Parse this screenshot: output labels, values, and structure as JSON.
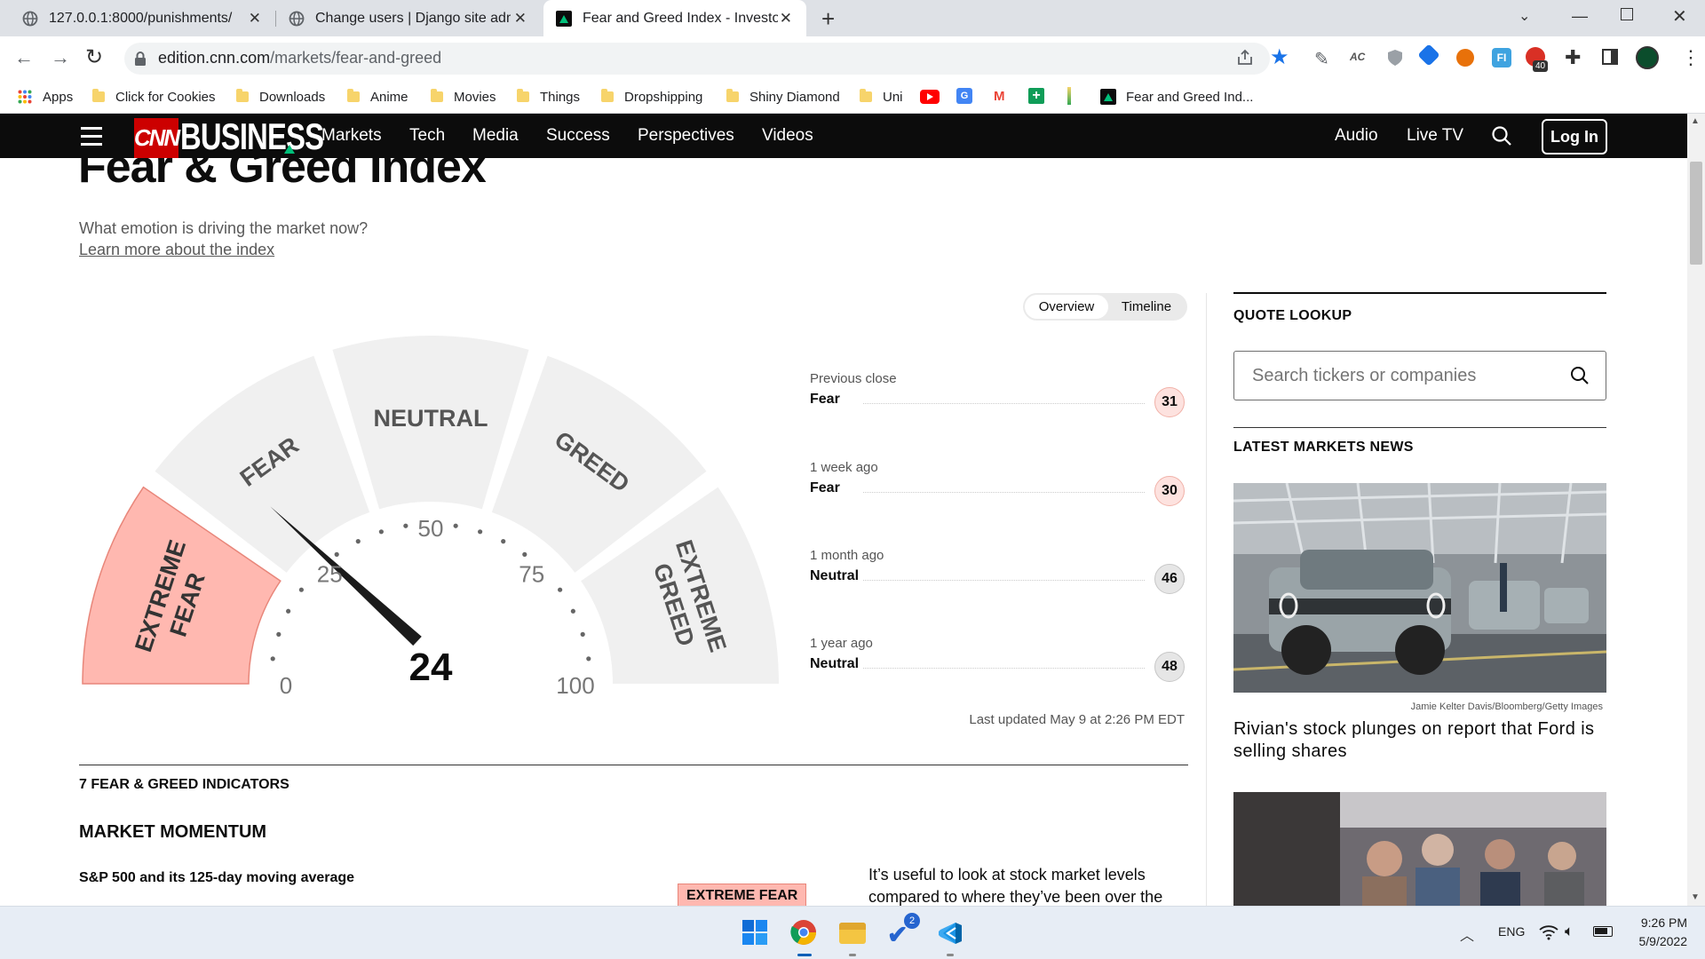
{
  "browser": {
    "tabs": [
      {
        "title": "127.0.0.1:8000/punishments/",
        "active": false
      },
      {
        "title": "Change users | Django site admin",
        "active": false
      },
      {
        "title": "Fear and Greed Index - Investor S",
        "active": true
      }
    ],
    "url_domain": "edition.cnn.com",
    "url_path": "/markets/fear-and-greed",
    "bookmarks": [
      "Apps",
      "Click for Cookies",
      "Downloads",
      "Anime",
      "Movies",
      "Things",
      "Dropshipping",
      "Shiny Diamond",
      "Uni",
      "Fear and Greed Ind..."
    ],
    "extension_badge": "40"
  },
  "nav": {
    "brand": "BUSINESS",
    "logo": "CNN",
    "links": [
      "Markets",
      "Tech",
      "Media",
      "Success",
      "Perspectives",
      "Videos"
    ],
    "right_links": [
      "Audio",
      "Live TV"
    ],
    "login": "Log In"
  },
  "page": {
    "title": "Fear & Greed Index",
    "subtitle": "What emotion is driving the market now?",
    "learn_more": "Learn more about the index"
  },
  "toggle": {
    "options": [
      "Overview",
      "Timeline"
    ],
    "selected": "Overview"
  },
  "gauge": {
    "value": 24,
    "segments": [
      "EXTREME FEAR",
      "FEAR",
      "NEUTRAL",
      "GREED",
      "EXTREME GREED"
    ],
    "ticks": [
      "0",
      "25",
      "50",
      "75",
      "100"
    ],
    "active_segment": "EXTREME FEAR"
  },
  "history": [
    {
      "label": "Previous close",
      "rating": "Fear",
      "value": "31"
    },
    {
      "label": "1 week ago",
      "rating": "Fear",
      "value": "30"
    },
    {
      "label": "1 month ago",
      "rating": "Neutral",
      "value": "46"
    },
    {
      "label": "1 year ago",
      "rating": "Neutral",
      "value": "48"
    }
  ],
  "last_updated": "Last updated May 9 at 2:26 PM EDT",
  "indicators": {
    "heading": "7 FEAR & GREED INDICATORS",
    "section": "MARKET MOMENTUM",
    "item_title": "S&P 500 and its 125-day moving average",
    "item_badge": "EXTREME FEAR",
    "item_text_1": "It’s useful to look at stock market levels",
    "item_text_2": "compared to where they’ve been over the"
  },
  "sidebar": {
    "quote_lookup": "QUOTE LOOKUP",
    "search_placeholder": "Search tickers or companies",
    "news_heading": "LATEST MARKETS NEWS",
    "photo_credit": "Jamie Kelter Davis/Bloomberg/Getty Images",
    "headline": "Rivian's stock plunges on report that Ford is selling shares"
  },
  "taskbar": {
    "language": "ENG",
    "time": "9:26 PM",
    "date": "5/9/2022",
    "todo_badge": "2"
  },
  "colors": {
    "extreme_fear": "#ffb8b0",
    "fear_chip": "#fde2df",
    "neutral_chip": "#e6e6e6",
    "cnn_red": "#cc0000",
    "chrome_blue": "#1a73e8"
  }
}
